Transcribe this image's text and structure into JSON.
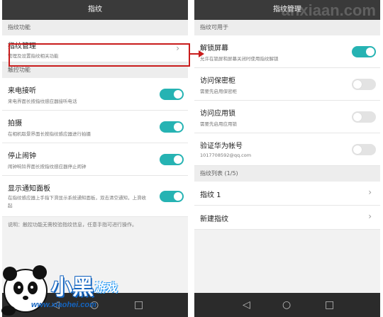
{
  "left": {
    "title": "指纹",
    "section1": "指纹功能",
    "manage": {
      "title": "指纹管理",
      "sub": "管理及设置指纹相关功能"
    },
    "section2": "触控功能",
    "items": [
      {
        "title": "来电接听",
        "sub": "来电界面长按指纹感应器接听电话",
        "on": true
      },
      {
        "title": "拍摄",
        "sub": "在相机取景界面长按指纹感应器进行拍摄",
        "on": true
      },
      {
        "title": "停止闹钟",
        "sub": "闹钟响铃界面长按指纹感应器停止闹钟",
        "on": true
      },
      {
        "title": "显示通知面板",
        "sub": "在指纹感应器上手指下滑显示系统通知面板，双击清空通知，上滑收起",
        "on": true
      }
    ],
    "note": "说明：触控功能无需校验指纹信息，任意手指可进行操作。"
  },
  "right": {
    "title": "指纹管理",
    "watermark": "anxiaan.com",
    "section1": "指纹可用于",
    "items": [
      {
        "title": "解锁屏幕",
        "sub": "允许在锁屏和屏幕关闭时使用指纹解锁",
        "on": true
      },
      {
        "title": "访问保密柜",
        "sub": "需要先启用保密柜",
        "on": false
      },
      {
        "title": "访问应用锁",
        "sub": "需要先启用应用锁",
        "on": false
      },
      {
        "title": "验证华为帐号",
        "sub": "1017708592@qq.com",
        "on": false
      }
    ],
    "section2": "指纹列表 (1/5)",
    "fingerprint1": "指纹 1",
    "new_fingerprint": "新建指纹"
  },
  "logo": {
    "brand": "小黑",
    "brand2": "游戏",
    "url": "www.xiaohei.com"
  },
  "colors": {
    "accent": "#26b3b3",
    "highlight": "#c91c1c",
    "titlebar": "#3a3a3a"
  },
  "icons": {
    "chevron": "chevron-right-icon",
    "back": "back-icon",
    "home": "home-icon",
    "recents": "recents-icon"
  }
}
